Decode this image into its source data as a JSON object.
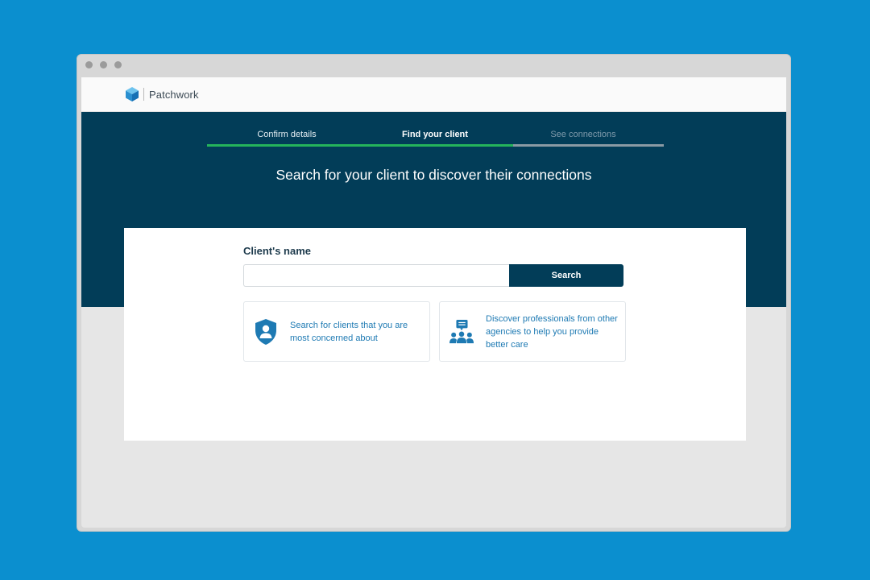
{
  "app": {
    "name": "Patchwork"
  },
  "steps": [
    {
      "label": "Confirm details",
      "state": "complete"
    },
    {
      "label": "Find your client",
      "state": "current"
    },
    {
      "label": "See connections",
      "state": "upcoming"
    }
  ],
  "progress": {
    "fraction": 0.67
  },
  "hero": {
    "title": "Search for your client to discover their connections"
  },
  "search": {
    "label": "Client's name",
    "value": "",
    "placeholder": "",
    "button_label": "Search"
  },
  "info_cards": [
    {
      "icon": "shield-person-icon",
      "text": "Search for clients that you are most concerned about"
    },
    {
      "icon": "people-chat-icon",
      "text": "Discover professionals from other agencies to help you provide better care"
    }
  ],
  "colors": {
    "page_background": "#0b8fcf",
    "hero_background": "#023d58",
    "progress_fill": "#25b45b",
    "link_text": "#1e7ab3"
  }
}
